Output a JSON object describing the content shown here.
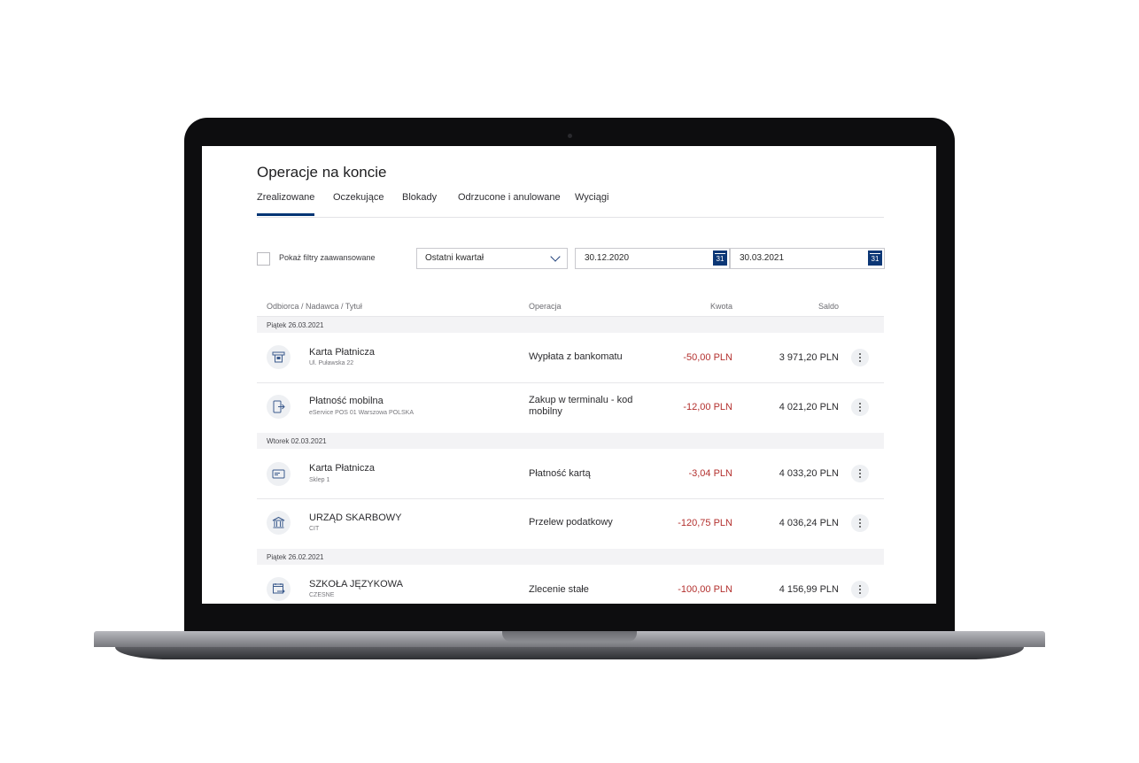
{
  "page": {
    "title": "Operacje na koncie"
  },
  "tabs": [
    {
      "label": "Zrealizowane",
      "active": true
    },
    {
      "label": "Oczekujące"
    },
    {
      "label": "Blokady"
    },
    {
      "label": "Odrzucone i anulowane"
    },
    {
      "label": "Wyciągi"
    }
  ],
  "filters": {
    "advanced_label": "Pokaż filtry zaawansowane",
    "period": "Ostatni kwartał",
    "date_from": "30.12.2020",
    "date_to": "30.03.2021",
    "calendar_day": "31"
  },
  "table": {
    "headers": {
      "party": "Odbiorca / Nadawca / Tytuł",
      "operation": "Operacja",
      "amount": "Kwota",
      "balance": "Saldo"
    },
    "groups": [
      {
        "date": "Piątek 26.03.2021",
        "rows": [
          {
            "icon": "atm-icon",
            "name": "Karta Płatnicza",
            "sub": "Ul. Puławska 22",
            "operation": "Wypłata z bankomatu",
            "amount": "-50,00 PLN",
            "balance": "3 971,20 PLN"
          },
          {
            "icon": "mobile-payment-icon",
            "name": "Płatność mobilna",
            "sub": "eService POS 01 Warszowa POLSKA",
            "operation": "Zakup w terminalu - kod mobilny",
            "amount": "-12,00 PLN",
            "balance": "4 021,20 PLN"
          }
        ]
      },
      {
        "date": "Wtorek 02.03.2021",
        "rows": [
          {
            "icon": "card-icon",
            "name": "Karta Płatnicza",
            "sub": "Sklep 1",
            "operation": "Płatność kartą",
            "amount": "-3,04 PLN",
            "balance": "4 033,20 PLN"
          },
          {
            "icon": "bank-building-icon",
            "name": "URZĄD SKARBOWY",
            "sub": "CIT",
            "operation": "Przelew podatkowy",
            "amount": "-120,75 PLN",
            "balance": "4 036,24 PLN"
          }
        ]
      },
      {
        "date": "Piątek 26.02.2021",
        "rows": [
          {
            "icon": "standing-order-icon",
            "name": "SZKOŁA JĘZYKOWA",
            "sub": "CZESNE",
            "operation": "Zlecenie stałe",
            "amount": "-100,00 PLN",
            "balance": "4 156,99 PLN"
          }
        ]
      }
    ]
  },
  "colors": {
    "accent": "#003574",
    "negative": "#b3302e"
  }
}
